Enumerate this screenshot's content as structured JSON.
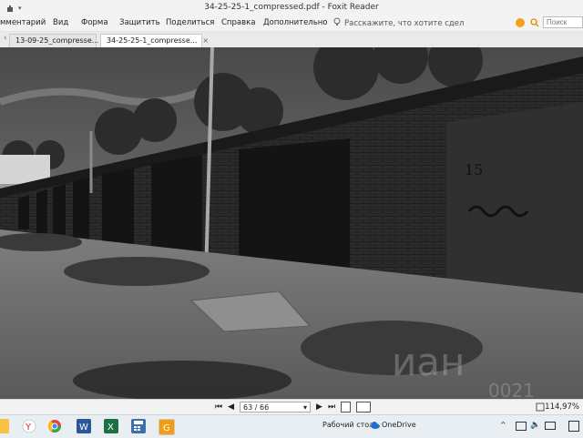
{
  "window": {
    "title": "34-25-25-1_compressed.pdf - Foxit Reader"
  },
  "menu": {
    "items": [
      "мментарий",
      "Вид",
      "Форма",
      "Защитить",
      "Поделиться",
      "Справка",
      "Дополнительно"
    ],
    "tellme": "Расскажите, что хотите сдел",
    "search_placeholder": "Поиск"
  },
  "tabs": [
    {
      "label": "13-09-25_compresse..."
    },
    {
      "label": "34-25-25-1_compresse..."
    }
  ],
  "document": {
    "garage_number": "15",
    "watermark_text": "иан",
    "watermark_digits": "0021"
  },
  "status": {
    "page_current": "63",
    "page_total": "66",
    "page_display": "63 / 66",
    "zoom": "114,97%"
  },
  "taskbar": {
    "desktop_label": "Рабочий стол",
    "onedrive_label": "OneDrive"
  },
  "colors": {
    "accent": "#2b6cb0",
    "foxit": "#f39c12"
  }
}
